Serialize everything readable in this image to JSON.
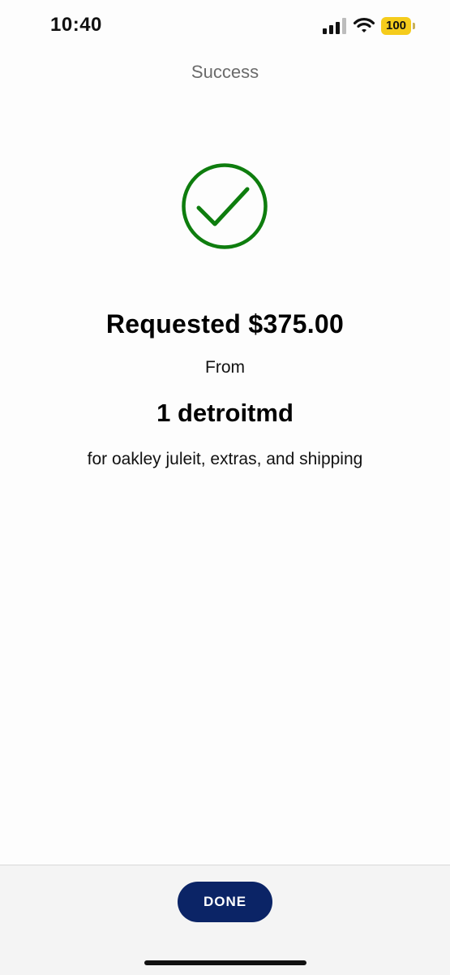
{
  "status_bar": {
    "time": "10:40",
    "battery_level": "100",
    "icons": [
      "signal-icon",
      "wifi-icon",
      "battery-icon"
    ]
  },
  "nav": {
    "title": "Success"
  },
  "confirmation": {
    "icon": "check-circle-icon",
    "headline": "Requested $375.00",
    "from_label": "From",
    "recipient": "1 detroitmd",
    "memo": "for oakley juleit, extras, and shipping"
  },
  "footer": {
    "done_label": "DONE"
  },
  "colors": {
    "success_green": "#0e7d0e",
    "button_navy": "#0b2466",
    "battery_yellow": "#f5cc1c"
  }
}
